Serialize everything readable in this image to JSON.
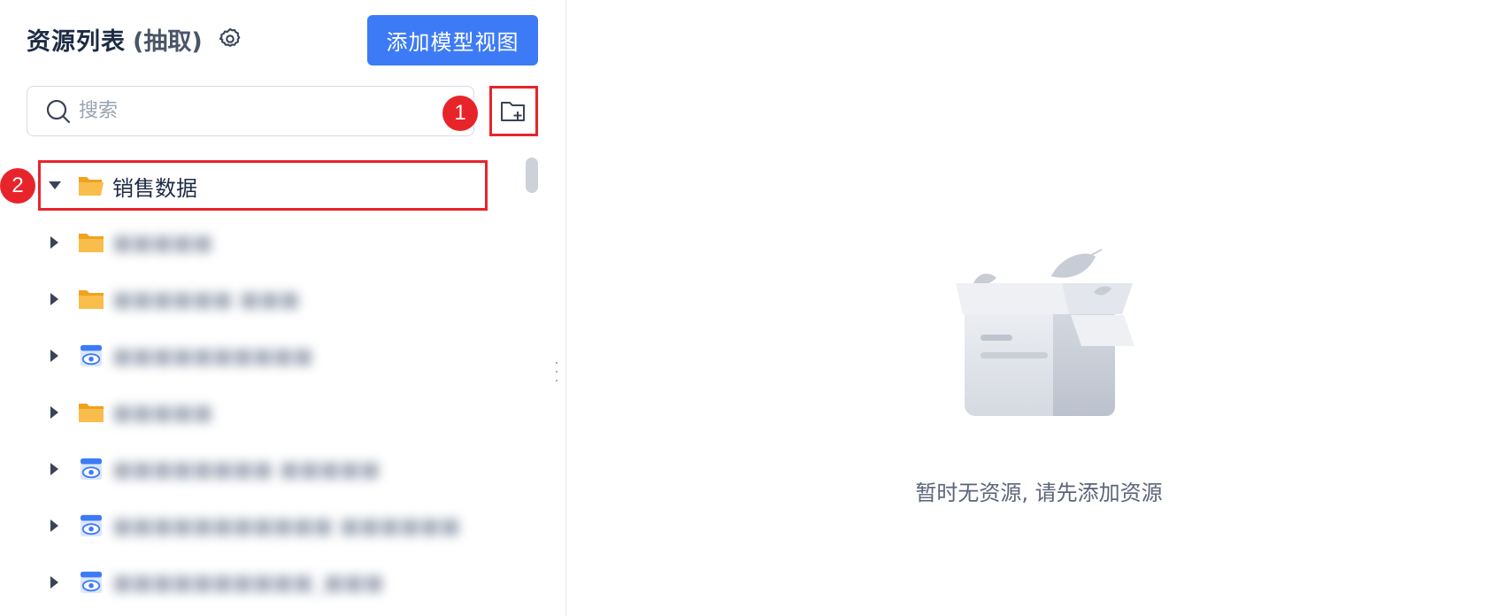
{
  "header": {
    "title": "资源列表",
    "subtitle": "(抽取)",
    "settings_icon": "gear-icon",
    "add_button_label": "添加模型视图"
  },
  "search": {
    "placeholder": "搜索",
    "value": "",
    "icon": "search-icon"
  },
  "toolbar": {
    "new_folder_icon": "folder-add-icon"
  },
  "annotations": {
    "badge_1": "1",
    "badge_2": "2"
  },
  "tree": {
    "root": {
      "label": "销售数据",
      "expanded": true,
      "icon": "folder-open-icon"
    },
    "children": [
      {
        "type": "folder",
        "label": "■■■■■"
      },
      {
        "type": "folder",
        "label": "■■■■■■ ■■■"
      },
      {
        "type": "view",
        "label": "■■■■■■■■■■"
      },
      {
        "type": "folder",
        "label": "■■■■■"
      },
      {
        "type": "view",
        "label": "■■■■■■■■ ■■■■■"
      },
      {
        "type": "view",
        "label": "■■■■■■■■■■■ ■■■■■■"
      },
      {
        "type": "view",
        "label": "■■■■■■■■■■_■■■"
      }
    ]
  },
  "empty_state": {
    "message": "暂时无资源, 请先添加资源",
    "icon": "empty-box-icon"
  },
  "colors": {
    "primary": "#3d7bf6",
    "highlight": "#e8242b",
    "folder": "#f6a623",
    "view_icon": "#3d7bf6"
  }
}
